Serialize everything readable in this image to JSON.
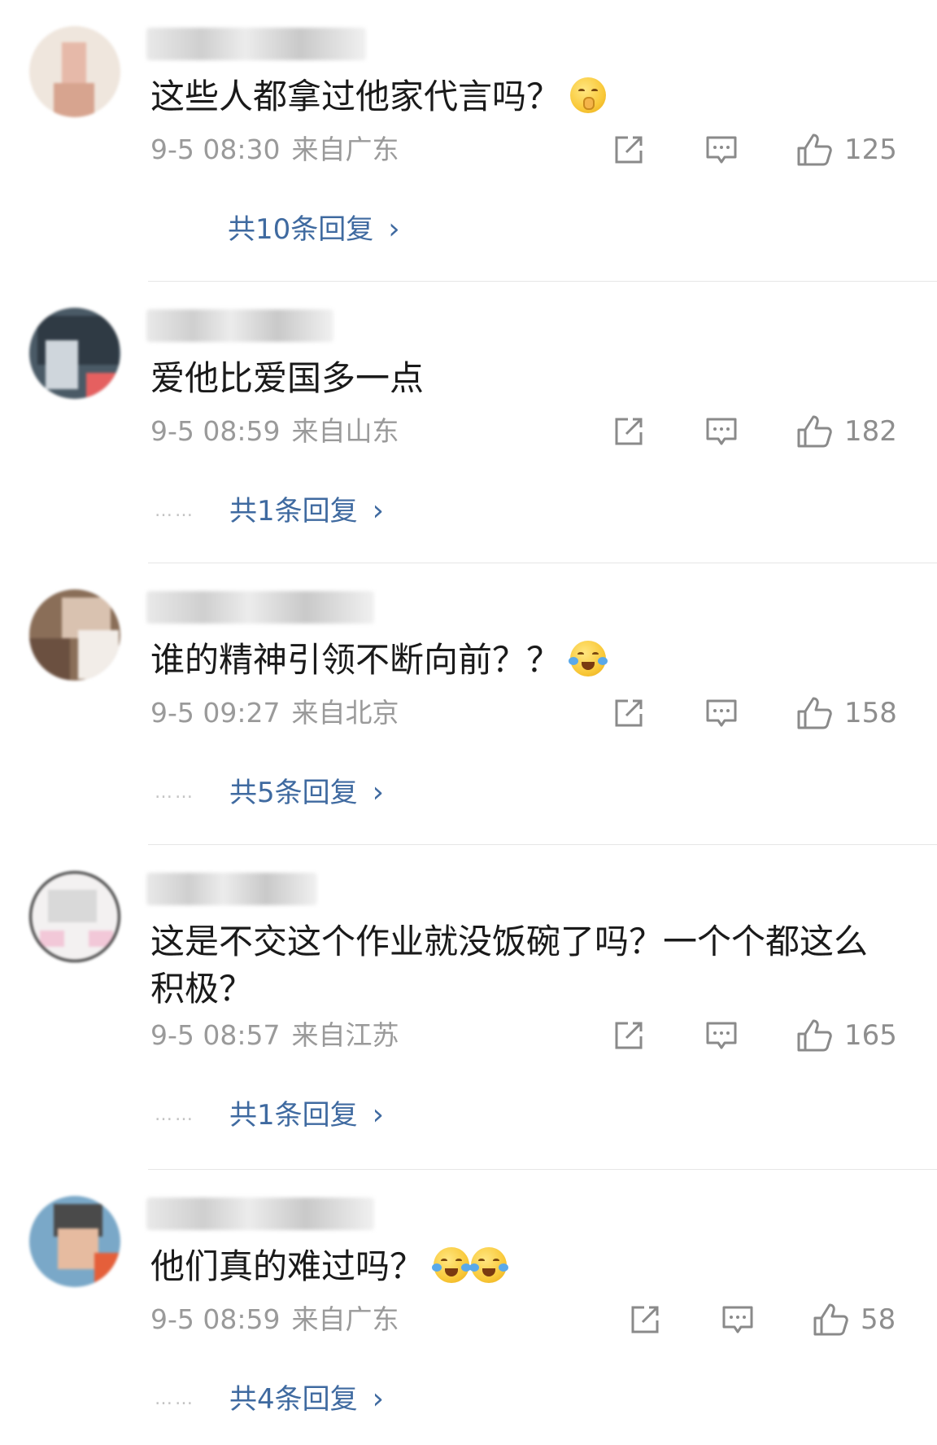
{
  "comments": [
    {
      "username": "嘻嘻",
      "text": "这些人都拿过他家代言吗？",
      "emoji": [
        "shushing-face-icon"
      ],
      "date": "9-5 08:30",
      "location": "来自广东",
      "likes": "125",
      "replies_label": "共10条回复",
      "show_dots": false
    },
    {
      "username": "",
      "text": "爱他比爱国多一点",
      "emoji": [],
      "date": "9-5 08:59",
      "location": "来自山东",
      "likes": "182",
      "replies_label": "共1条回复",
      "show_dots": true
    },
    {
      "username": "",
      "text": "谁的精神引领不断向前？？",
      "emoji": [
        "laugh-cry-icon"
      ],
      "date": "9-5 09:27",
      "location": "来自北京",
      "likes": "158",
      "replies_label": "共5条回复",
      "show_dots": true
    },
    {
      "username": "",
      "text": "这是不交这个作业就没饭碗了吗？一个个都这么积极？",
      "emoji": [],
      "date": "9-5 08:57",
      "location": "来自江苏",
      "likes": "165",
      "replies_label": "共1条回复",
      "show_dots": true
    },
    {
      "username": "",
      "text": "他们真的难过吗？",
      "emoji": [
        "laugh-cry-icon",
        "laugh-cry-icon"
      ],
      "date": "9-5 08:59",
      "location": "来自广东",
      "likes": "58",
      "replies_label": "共4条回复",
      "show_dots": true
    }
  ],
  "reply_dots": "……",
  "chevron": "›",
  "colors": {
    "link": "#3f6aa0",
    "meta": "#9a9a9a",
    "divider": "#e6e6e6"
  }
}
